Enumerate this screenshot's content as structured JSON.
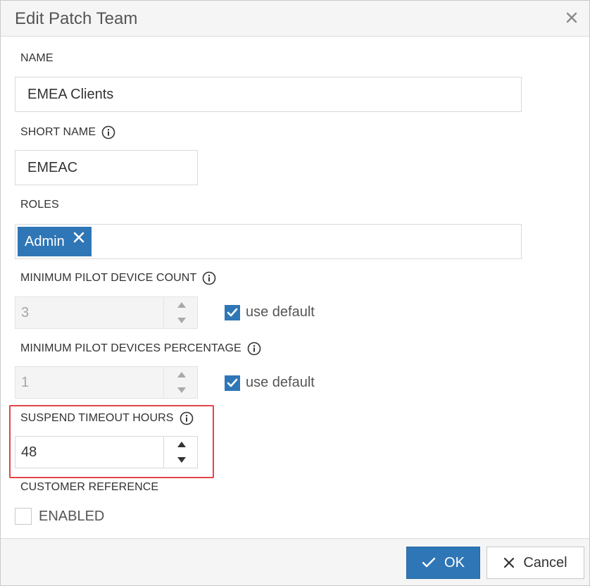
{
  "dialog": {
    "title": "Edit Patch Team",
    "close_icon": "close-icon"
  },
  "fields": {
    "name": {
      "label": "NAME",
      "value": "EMEA Clients"
    },
    "short_name": {
      "label": "SHORT NAME",
      "value": "EMEAC",
      "icon": "info-icon"
    },
    "roles": {
      "label": "ROLES",
      "chips": [
        "Admin"
      ]
    },
    "min_pilot_device_count": {
      "label": "MINIMUM PILOT DEVICE COUNT",
      "value": "3",
      "disabled": true,
      "use_default_label": "use default",
      "use_default_checked": true
    },
    "min_pilot_devices_percentage": {
      "label": "MINIMUM PILOT DEVICES PERCENTAGE",
      "value": "1",
      "disabled": true,
      "use_default_label": "use default",
      "use_default_checked": true
    },
    "suspend_timeout_hours": {
      "label": "SUSPEND TIMEOUT HOURS",
      "value": "48",
      "disabled": false
    },
    "customer_reference": {
      "label": "CUSTOMER REFERENCE",
      "enabled_label": "ENABLED",
      "enabled_checked": false
    }
  },
  "footer": {
    "ok_label": "OK",
    "cancel_label": "Cancel"
  },
  "colors": {
    "accent": "#2f76b6",
    "highlight_border": "#e0454b",
    "header_bg": "#f5f5f5"
  }
}
